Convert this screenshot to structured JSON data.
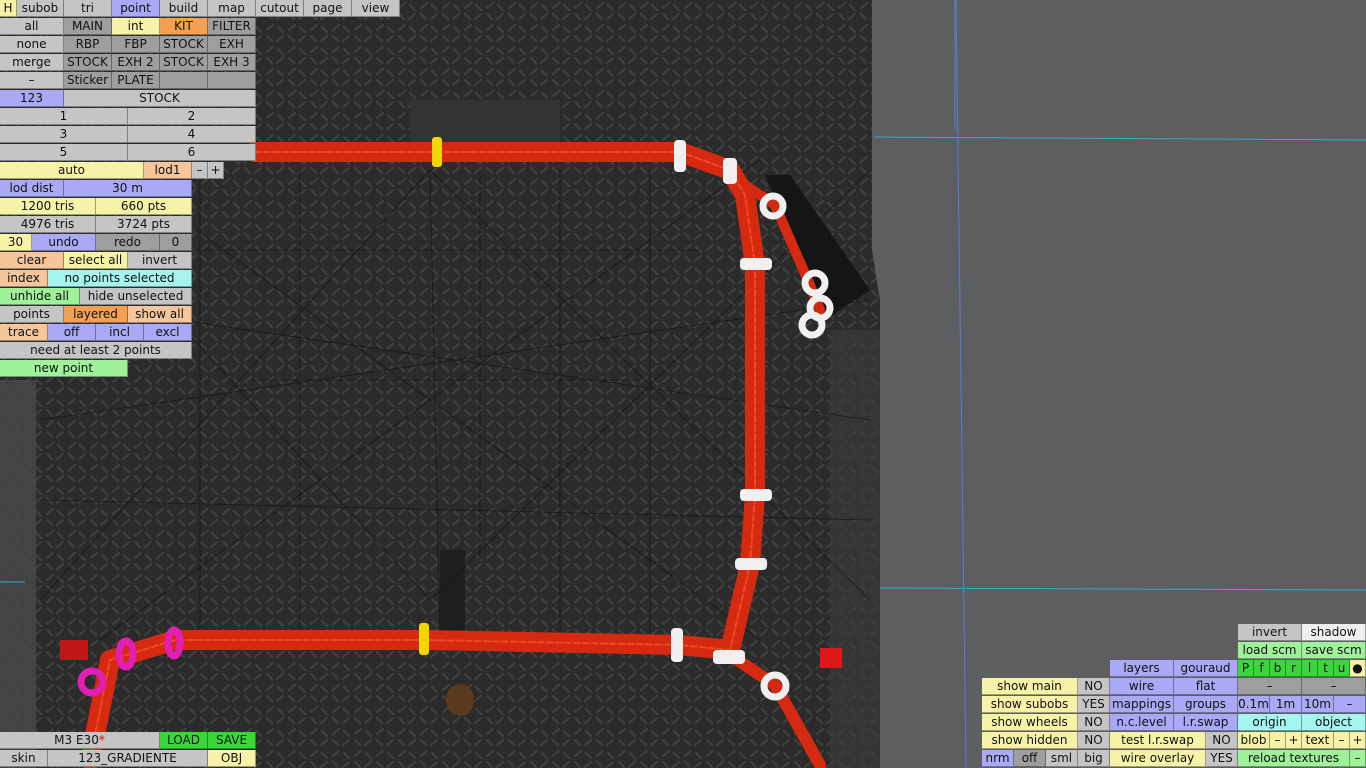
{
  "menu": {
    "h": "H",
    "items": [
      "subob",
      "tri",
      "point",
      "build",
      "map",
      "cutout",
      "page",
      "view"
    ]
  },
  "rows": {
    "r1": [
      "all",
      "MAIN",
      "int",
      "KIT",
      "FILTER"
    ],
    "r2": [
      "none",
      "RBP",
      "FBP",
      "STOCK",
      "EXH"
    ],
    "r3": [
      "merge",
      "STOCK",
      "EXH 2",
      "STOCK",
      "EXH 3"
    ],
    "r4": [
      "–",
      "Sticker",
      "PLATE"
    ]
  },
  "sel": {
    "id": "123",
    "name": "STOCK"
  },
  "nums": [
    "1",
    "2",
    "3",
    "4",
    "5",
    "6"
  ],
  "lod": {
    "auto": "auto",
    "lod": "lod1",
    "minus": "–",
    "plus": "+",
    "dist_label": "lod dist",
    "dist_value": "30 m"
  },
  "stats": {
    "tris1": "1200 tris",
    "pts1": "660 pts",
    "tris2": "4976 tris",
    "pts2": "3724 pts"
  },
  "undo": {
    "count": "30",
    "undo": "undo",
    "redo": "redo",
    "zero": "0"
  },
  "sel_ops": {
    "clear": "clear",
    "select_all": "select all",
    "invert": "invert"
  },
  "index": {
    "label": "index",
    "status": "no points selected"
  },
  "hide": {
    "unhide": "unhide all",
    "hide_unselected": "hide unselected"
  },
  "points": {
    "label": "points",
    "layered": "layered",
    "show_all": "show all"
  },
  "trace": {
    "label": "trace",
    "off": "off",
    "incl": "incl",
    "excl": "excl"
  },
  "need": "need at least 2 points",
  "new_point": "new point",
  "model": {
    "name": "M3 E30",
    "star": "*",
    "load": "LOAD",
    "save": "SAVE",
    "skin_label": "skin",
    "skin_value": "123_GRADIENTE",
    "obj": "OBJ"
  },
  "br": {
    "invert": "invert",
    "shadow": "shadow",
    "load_scm": "load scm",
    "save_scm": "save scm",
    "layers": "layers",
    "gouraud": "gouraud",
    "pfbrltu": [
      "P",
      "f",
      "b",
      "r",
      "l",
      "t",
      "u",
      "●"
    ],
    "show_main": "show main",
    "no": "NO",
    "yes": "YES",
    "wire": "wire",
    "flat": "flat",
    "dash": "–",
    "show_subobs": "show subobs",
    "mappings": "mappings",
    "groups": "groups",
    "d01": "0.1m",
    "d1": "1m",
    "d10": "10m",
    "show_wheels": "show wheels",
    "nclevel": "n.c.level",
    "lrswap": "l.r.swap",
    "origin": "origin",
    "object": "object",
    "show_hidden": "show hidden",
    "test_lrswap": "test l.r.swap",
    "blob": "blob",
    "minus": "–",
    "plus": "+",
    "text": "text",
    "nrm": "nrm",
    "off": "off",
    "sml": "sml",
    "big": "big",
    "wire_overlay": "wire overlay",
    "reload": "reload textures"
  }
}
